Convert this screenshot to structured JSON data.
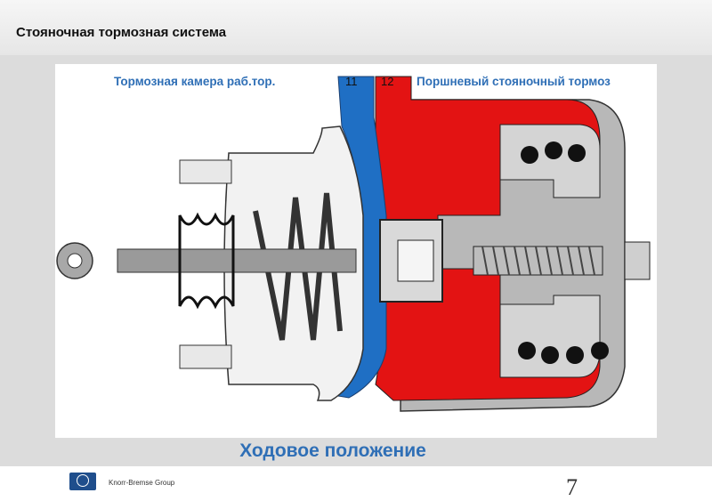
{
  "header": {
    "title": "Стояночная тормозная система"
  },
  "diagram": {
    "label_left": "Тормозная камера раб.тор.",
    "label_right": "Поршневый стояночный тормоз",
    "port_11": "11",
    "port_12": "12",
    "caption": "Ходовое положение"
  },
  "colors": {
    "service_air": "#1f6fc4",
    "parking_air": "#e31313",
    "housing": "#c9c9c9",
    "label_text": "#2f6fb6"
  },
  "footer": {
    "brand": "Knorr-Bremse Group",
    "page_number": "7"
  }
}
